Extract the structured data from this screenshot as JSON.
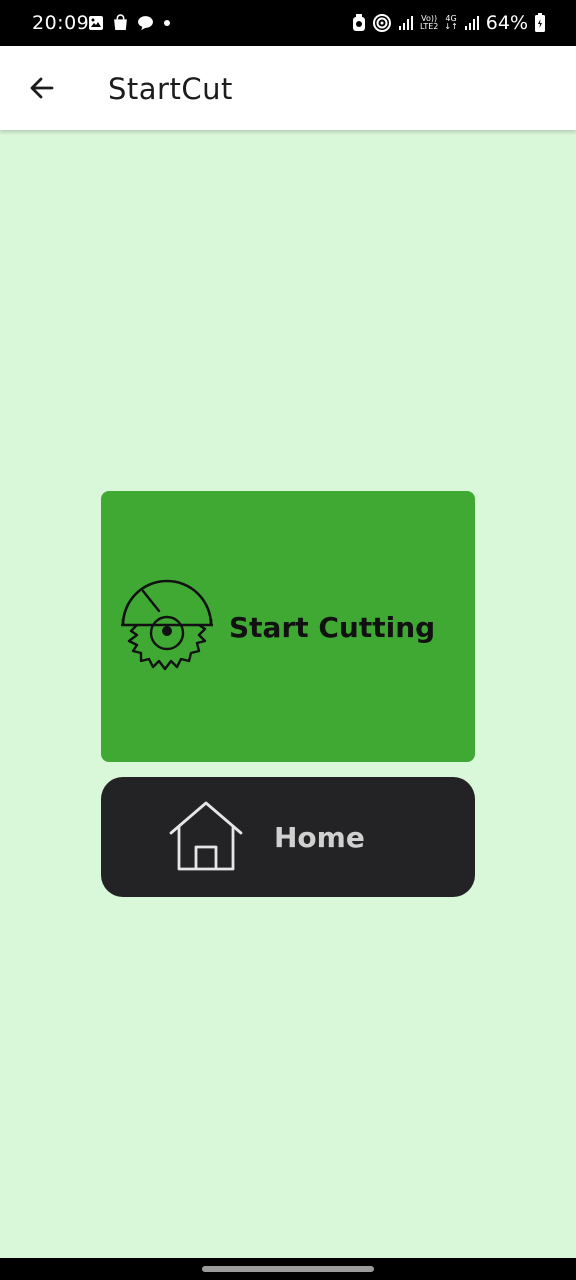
{
  "status_bar": {
    "time": "20:09",
    "battery": "64%",
    "network_top": "Vo))",
    "network_bottom": "LTE2",
    "network_gen": "4G",
    "left_icons": [
      "image-icon",
      "shopping-bag-icon",
      "chat-bubble-icon",
      "dot-icon"
    ],
    "right_icons": [
      "alarm-icon",
      "hotspot-icon",
      "signal-icon",
      "signal-icon",
      "battery-icon"
    ]
  },
  "app_bar": {
    "title": "StartCut",
    "back_icon": "arrow-left-icon"
  },
  "start_card": {
    "label": "Start Cutting",
    "icon": "circular-saw-icon",
    "color": "#3fa934"
  },
  "home_card": {
    "label": "Home",
    "icon": "house-icon",
    "color": "#232325"
  },
  "theme": {
    "background": "#d9f7d9",
    "app_bar": "#ffffff"
  }
}
